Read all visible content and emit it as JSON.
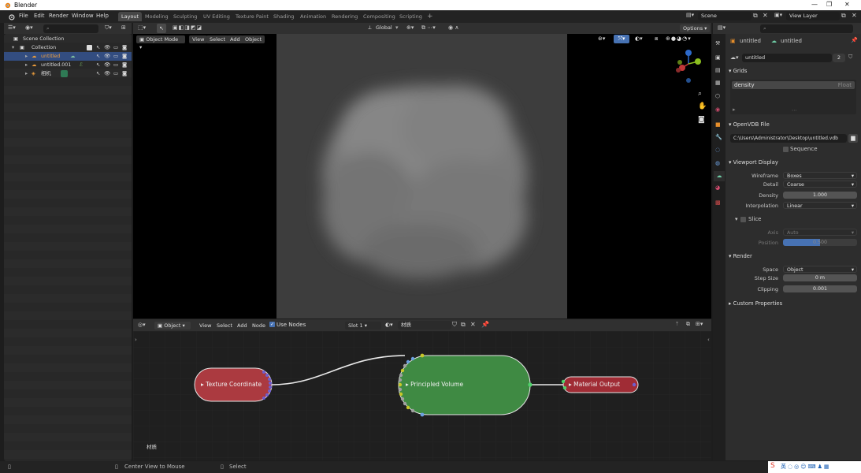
{
  "window": {
    "title": "Blender"
  },
  "menu": [
    "File",
    "Edit",
    "Render",
    "Window",
    "Help"
  ],
  "workspaces": [
    "Layout",
    "Modeling",
    "Sculpting",
    "UV Editing",
    "Texture Paint",
    "Shading",
    "Animation",
    "Rendering",
    "Compositing",
    "Scripting"
  ],
  "scene": {
    "label": "Scene",
    "view_layer": "View Layer"
  },
  "outliner": {
    "root": "Scene Collection",
    "collection": "Collection",
    "items": [
      {
        "label": "untitled"
      },
      {
        "label": "untitled.001"
      },
      {
        "label": "相机"
      }
    ]
  },
  "viewport": {
    "mode": "Object Mode",
    "menus": [
      "View",
      "Select",
      "Add",
      "Object"
    ],
    "transform": "Global",
    "options_label": "Options"
  },
  "node_editor": {
    "type": "Object",
    "menus": [
      "View",
      "Select",
      "Add",
      "Node"
    ],
    "use_nodes_label": "Use Nodes",
    "slot": "Slot 1",
    "material": "材质",
    "material_label": "材质",
    "nodes": {
      "texture": "Texture Coordinate",
      "volume": "Principled Volume",
      "output": "Material Output"
    }
  },
  "properties": {
    "object_name": "untitled",
    "data_name": "untitled",
    "data_block": "untitled",
    "user_count": "2",
    "grids_header": "Grids",
    "grid": {
      "name": "density",
      "type": "Float"
    },
    "openvdb_header": "OpenVDB File",
    "filepath": "C:\\Users\\Administrator\\Desktop\\untitled.vdb",
    "sequence_label": "Sequence",
    "viewport_display_header": "Viewport Display",
    "wireframe_label": "Wireframe",
    "wireframe_value": "Boxes",
    "detail_label": "Detail",
    "detail_value": "Coarse",
    "density_label": "Density",
    "density_value": "1.000",
    "interp_label": "Interpolation",
    "interp_value": "Linear",
    "slice_label": "Slice",
    "axis_label": "Axis",
    "axis_value": "Auto",
    "position_label": "Position",
    "position_value": "0.500",
    "render_header": "Render",
    "space_label": "Space",
    "space_value": "Object",
    "stepsize_label": "Step Size",
    "stepsize_value": "0 m",
    "clipping_label": "Clipping",
    "clipping_value": "0.001",
    "custom_header": "Custom Properties"
  },
  "status": {
    "left": "Center View to Mouse",
    "right": "Select"
  },
  "colors": {
    "accent": "#4772b3",
    "node_red": "#a83a3f",
    "node_green": "#3f8a43"
  }
}
